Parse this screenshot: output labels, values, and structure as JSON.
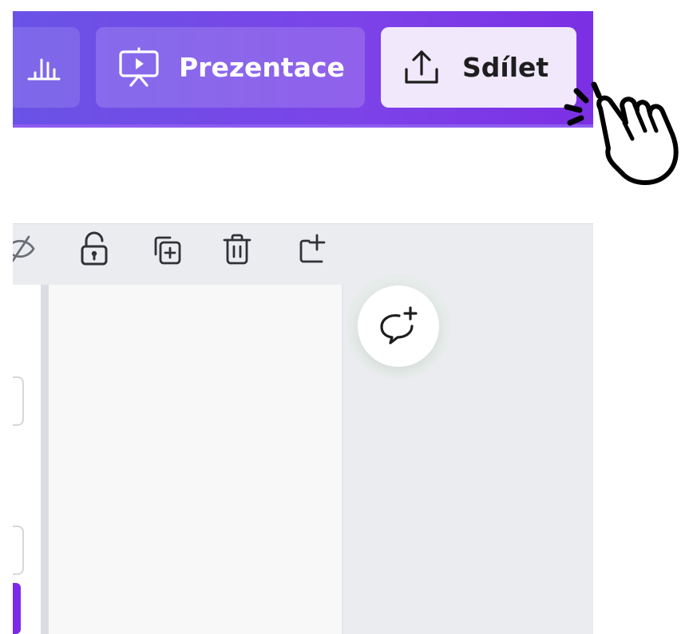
{
  "toolbar": {
    "present_label": "Prezentace",
    "share_label": "Sdílet"
  },
  "colors": {
    "topbar_start": "#6a53e6",
    "topbar_end": "#7c2fe4",
    "share_button_bg": "#f1e8fb",
    "brand_purple": "#7d2ae8",
    "canvas_bg": "#ebecf0"
  },
  "icons": {
    "insights": "bar-chart-icon",
    "present": "presentation-screen-icon",
    "share": "upload-share-icon",
    "page_tools": [
      "hide-eye-icon",
      "lock-icon",
      "duplicate-icon",
      "trash-icon",
      "add-page-icon"
    ],
    "comment": "add-comment-icon",
    "cursor": "pointing-hand-click-icon"
  }
}
